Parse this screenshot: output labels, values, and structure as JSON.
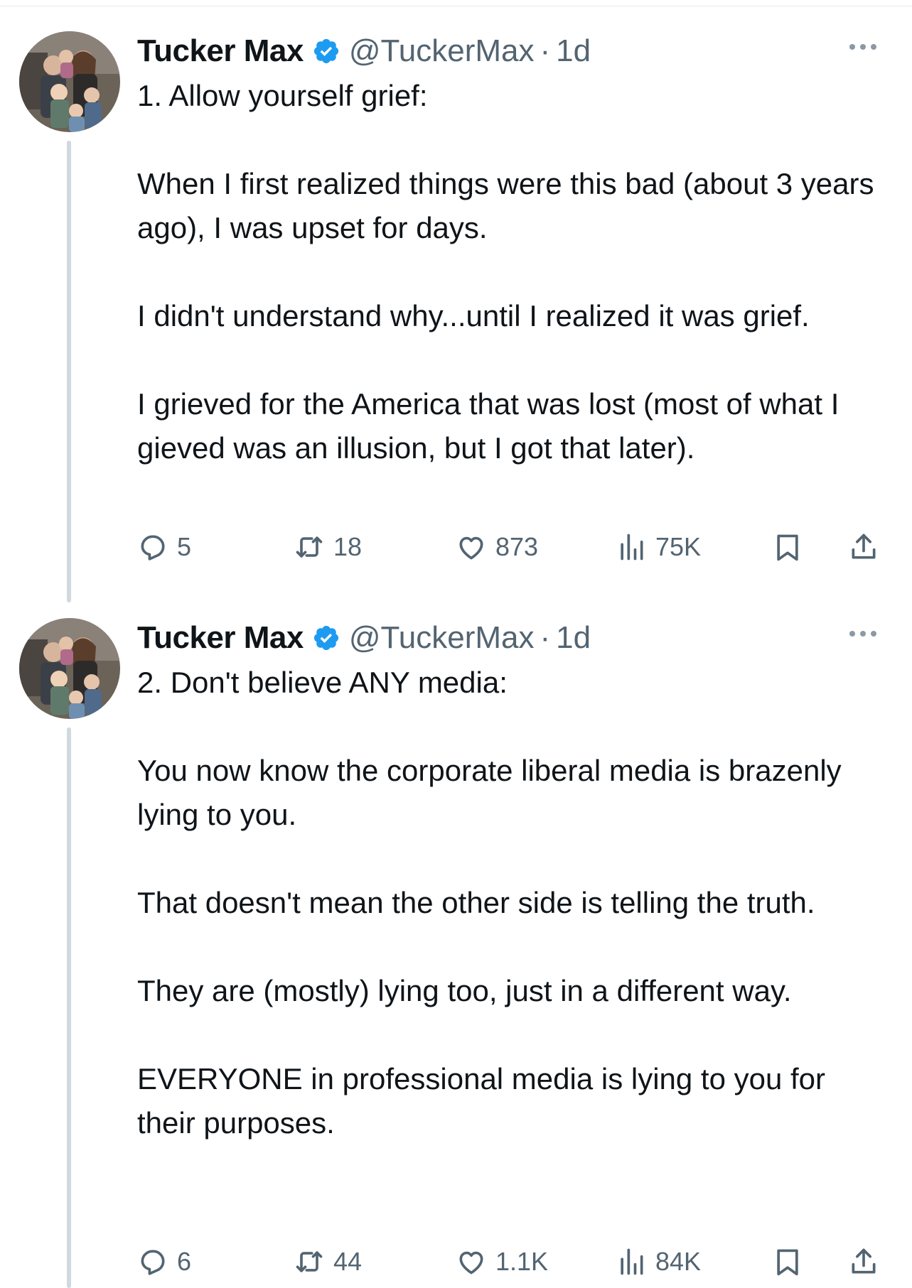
{
  "tweets": [
    {
      "author": {
        "name": "Tucker Max",
        "handle": "@TuckerMax",
        "separator": "·",
        "time": "1d",
        "verified_icon": "verified-badge-icon",
        "avatar": "avatar-family-photo"
      },
      "paragraphs": [
        "1. Allow yourself grief:",
        "When I first realized things were this bad (about 3 years ago), I was upset for days.",
        "I didn't understand why...until I realized it was grief.",
        "I grieved for the America that was lost (most of what I gieved was an illusion, but I got that later)."
      ],
      "metrics": {
        "replies": "5",
        "reposts": "18",
        "likes": "873",
        "views": "75K"
      }
    },
    {
      "author": {
        "name": "Tucker Max",
        "handle": "@TuckerMax",
        "separator": "·",
        "time": "1d",
        "verified_icon": "verified-badge-icon",
        "avatar": "avatar-family-photo"
      },
      "paragraphs": [
        "2. Don't believe ANY media:",
        "You now know the corporate liberal media is brazenly lying to you.",
        "That doesn't mean the other side is telling the truth.",
        "They are (mostly) lying too, just in a different way.",
        "EVERYONE in professional media is lying to you for their purposes."
      ],
      "metrics": {
        "replies": "6",
        "reposts": "44",
        "likes": "1.1K",
        "views": "84K"
      }
    }
  ],
  "colors": {
    "text": "#0f1419",
    "secondary": "#536471",
    "verified": "#1d9bf0",
    "thread_line": "#cfd9de"
  },
  "icons": [
    "reply-icon",
    "repost-icon",
    "like-icon",
    "views-icon",
    "bookmark-icon",
    "share-icon",
    "more-icon"
  ]
}
